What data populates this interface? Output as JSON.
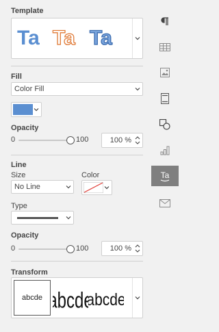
{
  "template": {
    "title": "Template",
    "samples": [
      "Ta",
      "Ta",
      "Ta"
    ]
  },
  "fill": {
    "title": "Fill",
    "type_value": "Color Fill",
    "color": "#5b8fd1",
    "opacity_label": "Opacity",
    "opacity_min": "0",
    "opacity_max": "100",
    "opacity_value": "100 %",
    "opacity_level": 1.0
  },
  "line": {
    "title": "Line",
    "size_label": "Size",
    "size_value": "No Line",
    "color_label": "Color",
    "type_label": "Type",
    "opacity_label": "Opacity",
    "opacity_min": "0",
    "opacity_max": "100",
    "opacity_value": "100 %",
    "opacity_level": 1.0
  },
  "transform": {
    "title": "Transform",
    "samples": [
      "abcde",
      "abcde",
      "abcde"
    ]
  },
  "rail": {
    "items": [
      "paragraph-icon",
      "table-icon",
      "image-icon",
      "slide-icon",
      "shape-icon",
      "chart-icon",
      "textart-icon",
      "mail-merge-icon"
    ],
    "active": "textart-icon"
  }
}
